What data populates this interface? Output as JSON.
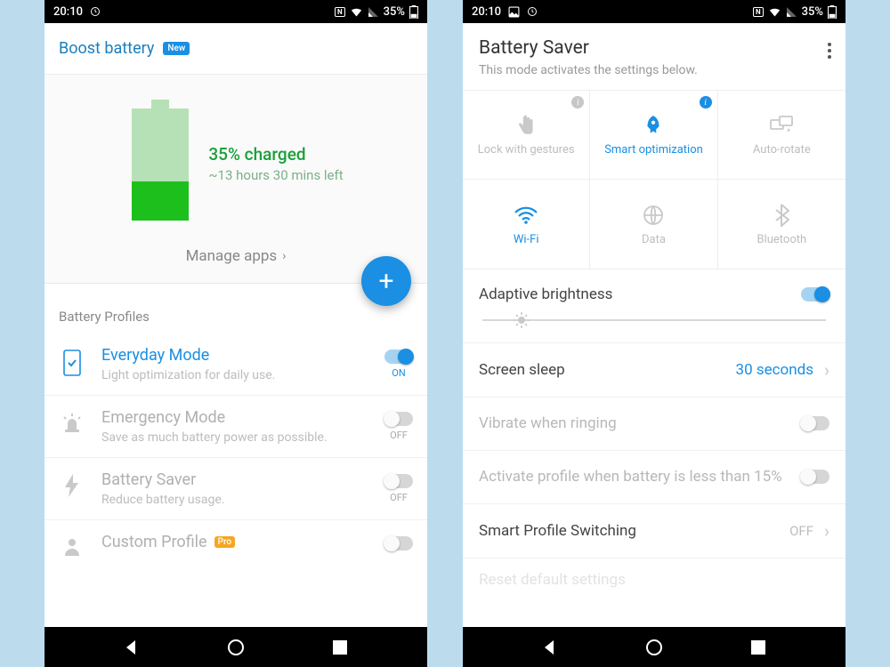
{
  "status": {
    "time": "20:10",
    "battery_percent": "35%"
  },
  "left": {
    "boost_title": "Boost battery",
    "new_badge": "New",
    "charged": "35% charged",
    "estimate": "~13 hours 30 mins left",
    "manage": "Manage apps",
    "profiles_label": "Battery Profiles",
    "profiles": [
      {
        "title": "Everyday Mode",
        "sub": "Light optimization for daily use.",
        "state": "ON"
      },
      {
        "title": "Emergency Mode",
        "sub": "Save as much battery power as possible.",
        "state": "OFF"
      },
      {
        "title": "Battery Saver",
        "sub": "Reduce battery usage.",
        "state": "OFF"
      },
      {
        "title": "Custom Profile",
        "badge": "Pro"
      }
    ]
  },
  "right": {
    "title": "Battery Saver",
    "subtitle": "This mode activates the settings below.",
    "grid": [
      "Lock with gestures",
      "Smart optimization",
      "Auto-rotate",
      "Wi-Fi",
      "Data",
      "Bluetooth"
    ],
    "adaptive": "Adaptive brightness",
    "sleep_label": "Screen sleep",
    "sleep_value": "30 seconds",
    "vibrate": "Vibrate when ringing",
    "activate": "Activate profile when battery is less than 15%",
    "smart_switch": "Smart Profile Switching",
    "smart_switch_state": "OFF",
    "reset": "Reset default settings"
  }
}
